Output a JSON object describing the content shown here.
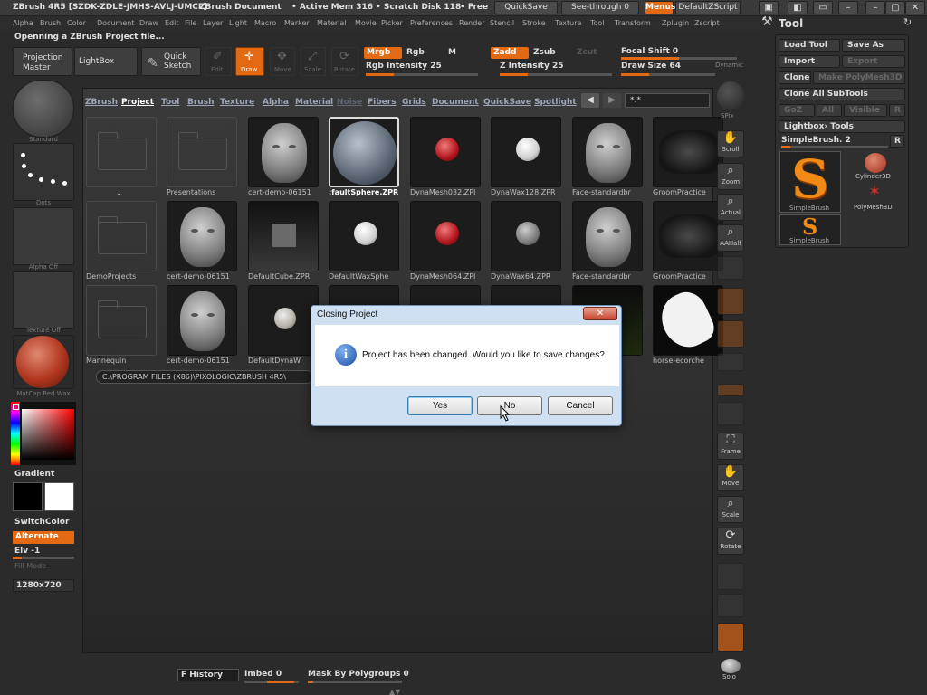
{
  "titlebar": {
    "app_title": "ZBrush 4R5 [SZDK-ZDLE-JMHS-AVLJ-UMCL]",
    "document": "ZBrush Document",
    "active_mem": "• Active Mem 316",
    "scratch_disk": "• Scratch Disk 118",
    "free": "• Free",
    "quicksave": "QuickSave",
    "see_through": "See-through  0",
    "menus": "Menus",
    "default_zscript": "DefaultZScript",
    "win_buttons": [
      "▣",
      "◧",
      "▭",
      "–",
      "▢",
      "✕"
    ]
  },
  "menubar": [
    "Alpha",
    "Brush",
    "Color",
    "Document",
    "Draw",
    "Edit",
    "File",
    "Layer",
    "Light",
    "Macro",
    "Marker",
    "Material",
    "Movie",
    "Picker",
    "Preferences",
    "Render",
    "Stencil",
    "Stroke",
    "Texture",
    "Tool",
    "Transform",
    "Zplugin",
    "Zscript"
  ],
  "status": "Openning a ZBrush Project file...",
  "shelf": {
    "projection_master": [
      "Projection",
      "Master"
    ],
    "lightbox": "LightBox",
    "quick_sketch": [
      "Quick",
      "Sketch"
    ],
    "edit": "Edit",
    "draw": "Draw",
    "move": "Move",
    "scale": "Scale",
    "rotate": "Rotate",
    "mrgb": "Mrgb",
    "rgb": "Rgb",
    "m": "M",
    "rgb_intensity": "Rgb  Intensity 25",
    "zadd": "Zadd",
    "zsub": "Zsub",
    "zcut": "Zcut",
    "z_intensity": "Z  Intensity 25",
    "focal_shift": "Focal  Shift 0",
    "draw_size": "Draw  Size 64",
    "dynamic": "Dynamic"
  },
  "levels": {
    "rgb_intensity": 0.25,
    "z_intensity": 0.25,
    "focal_shift": 0.5,
    "draw_size": 0.3
  },
  "left_panel": {
    "brush_label": "Standard",
    "stroke_label": "Dots",
    "alpha_label": "Alpha Off",
    "texture_label": "Texture Off",
    "material_label": "MatCap Red Wax",
    "gradient": "Gradient",
    "switch_color": "SwitchColor",
    "alternate": "Alternate",
    "elv": "Elv -1",
    "fill_mode": "Fill Mode",
    "resolution": "1280x720"
  },
  "lightbox": {
    "tabs": [
      "ZBrush",
      "Project",
      "Tool",
      "Brush",
      "Texture",
      "Alpha",
      "Material",
      "Noise",
      "Fibers",
      "Grids",
      "Document",
      "QuickSave",
      "Spotlight"
    ],
    "filter": "*.*",
    "items": [
      {
        "label": "..",
        "kind": "folder"
      },
      {
        "label": "Presentations",
        "kind": "folder"
      },
      {
        "label": "cert-demo-06151",
        "kind": "head"
      },
      {
        "label": ":faultSphere.ZPR",
        "kind": "sphere-grey",
        "selected": true
      },
      {
        "label": "DynaMesh032.ZPI",
        "kind": "ball-red"
      },
      {
        "label": "DynaWax128.ZPR",
        "kind": "ball-white"
      },
      {
        "label": "Face-standardbr",
        "kind": "head"
      },
      {
        "label": "GroomPractice",
        "kind": "dark-fur"
      },
      {
        "label": "DemoProjects",
        "kind": "folder"
      },
      {
        "label": "cert-demo-06151",
        "kind": "head"
      },
      {
        "label": "DefaultCube.ZPR",
        "kind": "cube"
      },
      {
        "label": "DefaultWaxSphe",
        "kind": "ball-white"
      },
      {
        "label": "DynaMesh064.ZPI",
        "kind": "ball-red"
      },
      {
        "label": "DynaWax64.ZPR",
        "kind": "ball-grey"
      },
      {
        "label": "Face-standardbr",
        "kind": "head"
      },
      {
        "label": "GroomPractice",
        "kind": "dark-fur"
      },
      {
        "label": "Mannequin",
        "kind": "folder"
      },
      {
        "label": "cert-demo-06151",
        "kind": "head"
      },
      {
        "label": "DefaultDynaW",
        "kind": "ball-small"
      },
      {
        "label": "",
        "kind": "blank"
      },
      {
        "label": "",
        "kind": "blank"
      },
      {
        "label": "",
        "kind": "ball-grey"
      },
      {
        "label": ".ZPR",
        "kind": "grass"
      },
      {
        "label": "horse-ecorche",
        "kind": "horse"
      }
    ],
    "path": "C:\\PROGRAM FILES (X86)\\PIXOLOGIC\\ZBRUSH 4R5\\"
  },
  "nav": {
    "bpr": "BPR",
    "spix": "SPix",
    "scroll": "Scroll",
    "zoom": "Zoom",
    "actual": "Actual",
    "aahalf": "AAHalf",
    "frame": "Frame",
    "move": "Move",
    "scale": "Scale",
    "rotate": "Rotate",
    "solo": "Solo"
  },
  "tool_panel": {
    "title": "Tool",
    "load_tool": "Load Tool",
    "save_as": "Save As",
    "import": "Import",
    "export": "Export",
    "clone": "Clone",
    "make_polymesh": "Make PolyMesh3D",
    "clone_all": "Clone All SubTools",
    "goz": "GoZ",
    "all": "All",
    "visible": "Visible",
    "r": "R",
    "lightbox_tools": "Lightbox› Tools",
    "simplebrush": "SimpleBrush. 2",
    "tools": [
      {
        "label": "SimpleBrush",
        "glyph": "S"
      },
      {
        "label": "Cylinder3D",
        "glyph": "●"
      },
      {
        "label": "PolyMesh3D",
        "glyph": "✶"
      },
      {
        "label": "SimpleBrush",
        "glyph": "S"
      }
    ]
  },
  "dialog": {
    "title": "Closing Project",
    "close_glyph": "✕",
    "info_glyph": "i",
    "message": "Project has been changed. Would you like to save changes?",
    "yes": "Yes",
    "no": "No",
    "cancel": "Cancel"
  },
  "bottom": {
    "f_history": "F History",
    "imbed": "Imbed 0",
    "mask_by_polygroups": "Mask By Polygroups 0"
  },
  "colors": {
    "accent": "#e36a12",
    "dialog_chrome": "#cfe0f3"
  }
}
